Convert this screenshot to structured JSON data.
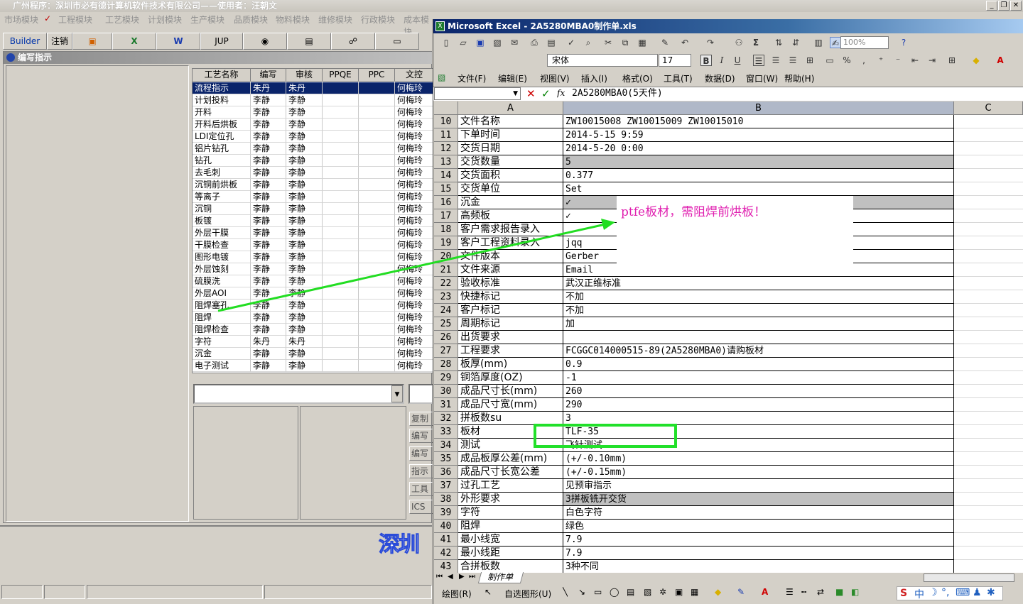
{
  "bg_app": {
    "title": "广州程序：深圳市必有德计算机软件技术有限公司——使用者：汪朝文",
    "menu": [
      "市场模块",
      "工程模块",
      "工艺模块",
      "计划模块",
      "生产模块",
      "品质模块",
      "物料模块",
      "维修模块",
      "行政模块",
      "成本模块"
    ],
    "active_menu_check": "✓",
    "toolbar": {
      "builder": "Builder",
      "logout": "注销",
      "jup": "JUP"
    },
    "edit_window_title": "编写指示",
    "grid_headers": [
      "工艺名称",
      "编写",
      "审核",
      "PPQE",
      "PPC",
      "文控"
    ],
    "grid_rows": [
      [
        "流程指示",
        "朱丹",
        "朱丹",
        "",
        "",
        "何梅玲"
      ],
      [
        "计划投料",
        "李静",
        "李静",
        "",
        "",
        "何梅玲"
      ],
      [
        "开料",
        "李静",
        "李静",
        "",
        "",
        "何梅玲"
      ],
      [
        "开料后烘板",
        "李静",
        "李静",
        "",
        "",
        "何梅玲"
      ],
      [
        "LDI定位孔",
        "李静",
        "李静",
        "",
        "",
        "何梅玲"
      ],
      [
        "铝片钻孔",
        "李静",
        "李静",
        "",
        "",
        "何梅玲"
      ],
      [
        "钻孔",
        "李静",
        "李静",
        "",
        "",
        "何梅玲"
      ],
      [
        "去毛刺",
        "李静",
        "李静",
        "",
        "",
        "何梅玲"
      ],
      [
        "沉铜前烘板",
        "李静",
        "李静",
        "",
        "",
        "何梅玲"
      ],
      [
        "等离子",
        "李静",
        "李静",
        "",
        "",
        "何梅玲"
      ],
      [
        "沉铜",
        "李静",
        "李静",
        "",
        "",
        "何梅玲"
      ],
      [
        "板镀",
        "李静",
        "李静",
        "",
        "",
        "何梅玲"
      ],
      [
        "外层干膜",
        "李静",
        "李静",
        "",
        "",
        "何梅玲"
      ],
      [
        "干膜检查",
        "李静",
        "李静",
        "",
        "",
        "何梅玲"
      ],
      [
        "图形电镀",
        "李静",
        "李静",
        "",
        "",
        "何梅玲"
      ],
      [
        "外层蚀刻",
        "李静",
        "李静",
        "",
        "",
        "何梅玲"
      ],
      [
        "硫膜洗",
        "李静",
        "李静",
        "",
        "",
        "何梅玲"
      ],
      [
        "外层AOI",
        "李静",
        "李静",
        "",
        "",
        "何梅玲"
      ],
      [
        "阻焊塞孔",
        "李静",
        "李静",
        "",
        "",
        "何梅玲"
      ],
      [
        "阻焊",
        "李静",
        "李静",
        "",
        "",
        "何梅玲"
      ],
      [
        "阻焊检查",
        "李静",
        "李静",
        "",
        "",
        "何梅玲"
      ],
      [
        "字符",
        "朱丹",
        "朱丹",
        "",
        "",
        "何梅玲"
      ],
      [
        "沉金",
        "李静",
        "李静",
        "",
        "",
        "何梅玲"
      ],
      [
        "电子测试",
        "李静",
        "李静",
        "",
        "",
        "何梅玲"
      ]
    ],
    "side_buttons": [
      "复制",
      "编写",
      "编写",
      "指示",
      "工具",
      "ICS"
    ],
    "stamp_text": "深圳"
  },
  "excel": {
    "title": "Microsoft Excel - 2A5280MBA0制作单.xls",
    "icon": "X",
    "font_name": "宋体",
    "font_size": "17",
    "zoom": "100%",
    "menu": [
      "文件(F)",
      "编辑(E)",
      "视图(V)",
      "插入(I)",
      "格式(O)",
      "工具(T)",
      "数据(D)",
      "窗口(W)",
      "帮助(H)"
    ],
    "fx_label": "fx",
    "formula": "2A5280MBA0(5天件)",
    "columns": [
      "A",
      "B",
      "C"
    ],
    "rows": [
      {
        "n": "10",
        "a": "文件名称",
        "b": "ZW10015008 ZW10015009 ZW10015010"
      },
      {
        "n": "11",
        "a": "下单时间",
        "b": "2014-5-15 9:59"
      },
      {
        "n": "12",
        "a": "交货日期",
        "b": "2014-5-20 0:00"
      },
      {
        "n": "13",
        "a": "交货数量",
        "b": "5"
      },
      {
        "n": "14",
        "a": "交货面积",
        "b": "0.377"
      },
      {
        "n": "15",
        "a": "交货单位",
        "b": "Set"
      },
      {
        "n": "16",
        "a": "沉金",
        "b": "✓"
      },
      {
        "n": "17",
        "a": "高频板",
        "b": "✓"
      },
      {
        "n": "18",
        "a": "客户需求报告录入",
        "b": ""
      },
      {
        "n": "19",
        "a": "客户工程资料录入",
        "b": "jqq"
      },
      {
        "n": "20",
        "a": "文件版本",
        "b": "Gerber"
      },
      {
        "n": "21",
        "a": "文件来源",
        "b": "Email"
      },
      {
        "n": "22",
        "a": "验收标准",
        "b": "武汉正维标准"
      },
      {
        "n": "23",
        "a": "快捷标记",
        "b": "不加"
      },
      {
        "n": "24",
        "a": "客户标记",
        "b": "不加"
      },
      {
        "n": "25",
        "a": "周期标记",
        "b": "加"
      },
      {
        "n": "26",
        "a": "出货要求",
        "b": ""
      },
      {
        "n": "27",
        "a": "工程要求",
        "b": "FCGGC014000515-89(2A5280MBA0)请购板材"
      },
      {
        "n": "28",
        "a": "板厚(mm)",
        "b": "0.9"
      },
      {
        "n": "29",
        "a": "铜箔厚度(OZ)",
        "b": "-1"
      },
      {
        "n": "30",
        "a": "成品尺寸长(mm)",
        "b": "260"
      },
      {
        "n": "31",
        "a": "成品尺寸宽(mm)",
        "b": "290"
      },
      {
        "n": "32",
        "a": "拼板数su",
        "b": "3"
      },
      {
        "n": "33",
        "a": "板材",
        "b": "TLF-35"
      },
      {
        "n": "34",
        "a": "测试",
        "b": "飞针测试"
      },
      {
        "n": "35",
        "a": "成品板厚公差(mm)",
        "b": "(+/-0.10mm)"
      },
      {
        "n": "36",
        "a": "成品尺寸长宽公差",
        "b": "(+/-0.15mm)"
      },
      {
        "n": "37",
        "a": "过孔工艺",
        "b": "见预审指示"
      },
      {
        "n": "38",
        "a": "外形要求",
        "b": "3拼板铣开交货"
      },
      {
        "n": "39",
        "a": "字符",
        "b": "白色字符"
      },
      {
        "n": "40",
        "a": "阻焊",
        "b": "绿色"
      },
      {
        "n": "41",
        "a": "最小线宽",
        "b": "7.9"
      },
      {
        "n": "42",
        "a": "最小线距",
        "b": "7.9"
      },
      {
        "n": "43",
        "a": "合拼板数",
        "b": "3种不同"
      }
    ],
    "comment": "ptfe板材，需阻焊前烘板！",
    "sheet_tab": "制作单",
    "draw_label": "绘图(R)",
    "autoshape_label": "自选图形(U)",
    "ime_text": "中"
  },
  "colors": {
    "arrow": "#22dd22",
    "highlight_box": "#22e02a",
    "comment_text": "#e020b0",
    "selection": "#0a246a"
  }
}
